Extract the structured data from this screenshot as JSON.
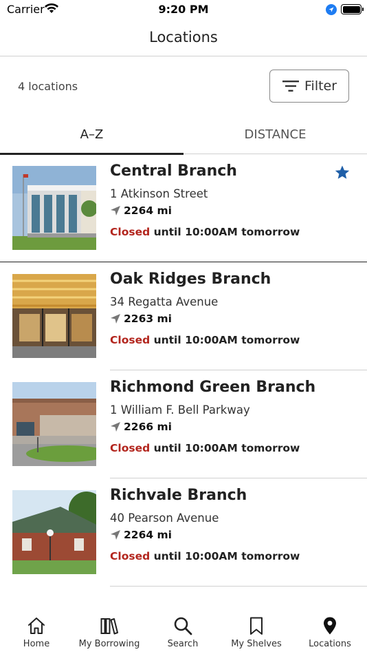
{
  "status_bar": {
    "carrier": "Carrier",
    "time": "9:20 PM"
  },
  "nav": {
    "title": "Locations"
  },
  "summary": {
    "count_label": "4 locations",
    "filter_label": "Filter"
  },
  "tabs": [
    {
      "label": "A–Z",
      "selected": true
    },
    {
      "label": "DISTANCE",
      "selected": false
    }
  ],
  "locations": [
    {
      "name": "Central Branch",
      "address": "1 Atkinson Street",
      "distance": "2264 mi",
      "status": "Closed",
      "hours": " until 10:00AM tomorrow",
      "favorite": true
    },
    {
      "name": "Oak Ridges Branch",
      "address": "34 Regatta Avenue",
      "distance": "2263 mi",
      "status": "Closed",
      "hours": " until 10:00AM tomorrow",
      "favorite": false
    },
    {
      "name": "Richmond Green Branch",
      "address": "1 William F. Bell Parkway",
      "distance": "2266 mi",
      "status": "Closed",
      "hours": " until 10:00AM tomorrow",
      "favorite": false
    },
    {
      "name": "Richvale Branch",
      "address": "40 Pearson Avenue",
      "distance": "2264 mi",
      "status": "Closed",
      "hours": " until 10:00AM tomorrow",
      "favorite": false
    }
  ],
  "tab_bar": [
    {
      "label": "Home",
      "icon": "home-icon",
      "selected": false
    },
    {
      "label": "My Borrowing",
      "icon": "books-icon",
      "selected": false
    },
    {
      "label": "Search",
      "icon": "search-icon",
      "selected": false
    },
    {
      "label": "My Shelves",
      "icon": "bookmark-icon",
      "selected": false
    },
    {
      "label": "Locations",
      "icon": "location-pin-icon",
      "selected": true
    }
  ],
  "colors": {
    "closed": "#b3261e",
    "favorite_star": "#1f5fa8",
    "text": "#222222"
  }
}
